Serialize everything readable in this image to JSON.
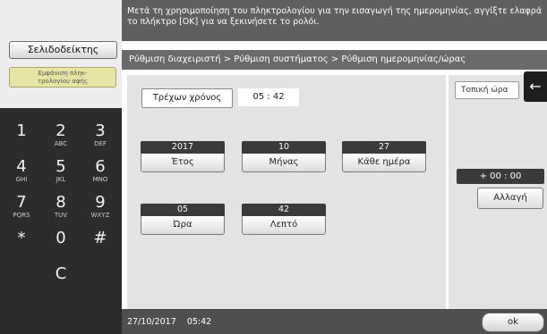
{
  "left_panel": {
    "bookmark_label": "Σελιδοδείκτης",
    "keypad_display_label": "Εμφάνιση πληκ-\nτρολογίου αφής",
    "keys": [
      {
        "digit": "1",
        "letters": ""
      },
      {
        "digit": "2",
        "letters": "ABC"
      },
      {
        "digit": "3",
        "letters": "DEF"
      },
      {
        "digit": "4",
        "letters": "GHI"
      },
      {
        "digit": "5",
        "letters": "JKL"
      },
      {
        "digit": "6",
        "letters": "MNO"
      },
      {
        "digit": "7",
        "letters": "PQRS"
      },
      {
        "digit": "8",
        "letters": "TUV"
      },
      {
        "digit": "9",
        "letters": "WXYZ"
      },
      {
        "digit": "*",
        "letters": ""
      },
      {
        "digit": "0",
        "letters": ""
      },
      {
        "digit": "#",
        "letters": ""
      },
      {
        "digit": "C",
        "letters": ""
      }
    ]
  },
  "message": "Μετά τη χρησιμοποίηση του πληκτρολογίου για την εισαγωγή της ημερομηνίας, αγγίξτε ελαφρά το πλήκτρο [OK] για να ξεκινήσετε το ρολόι.",
  "breadcrumb": "Ρύθμιση διαχειριστή > Ρύθμιση συστήματος > Ρύθμιση ημερομηνίας/ώρας",
  "current_time": {
    "label": "Τρέχων χρόνος",
    "value": "05 : 42"
  },
  "fields": {
    "year": {
      "value": "2017",
      "label": "Έτος"
    },
    "month": {
      "value": "10",
      "label": "Μήνας"
    },
    "day": {
      "value": "27",
      "label": "Κάθε ημέρα"
    },
    "hour": {
      "value": "05",
      "label": "Ώρα"
    },
    "minute": {
      "value": "42",
      "label": "Λεπτό"
    }
  },
  "timezone": {
    "label": "Τοπική ώρα",
    "offset": "+ 00 : 00",
    "change_label": "Αλλαγή"
  },
  "back_icon": "←",
  "footer": {
    "datetime": "27/10/2017    05:42",
    "ok_label": "ok"
  },
  "colors": {
    "keypad_bg": "#2c2c2c",
    "keypad_button": "#e7e4a6",
    "header_bg": "#5f5f5f",
    "panel_bg": "#e3e3e3"
  }
}
